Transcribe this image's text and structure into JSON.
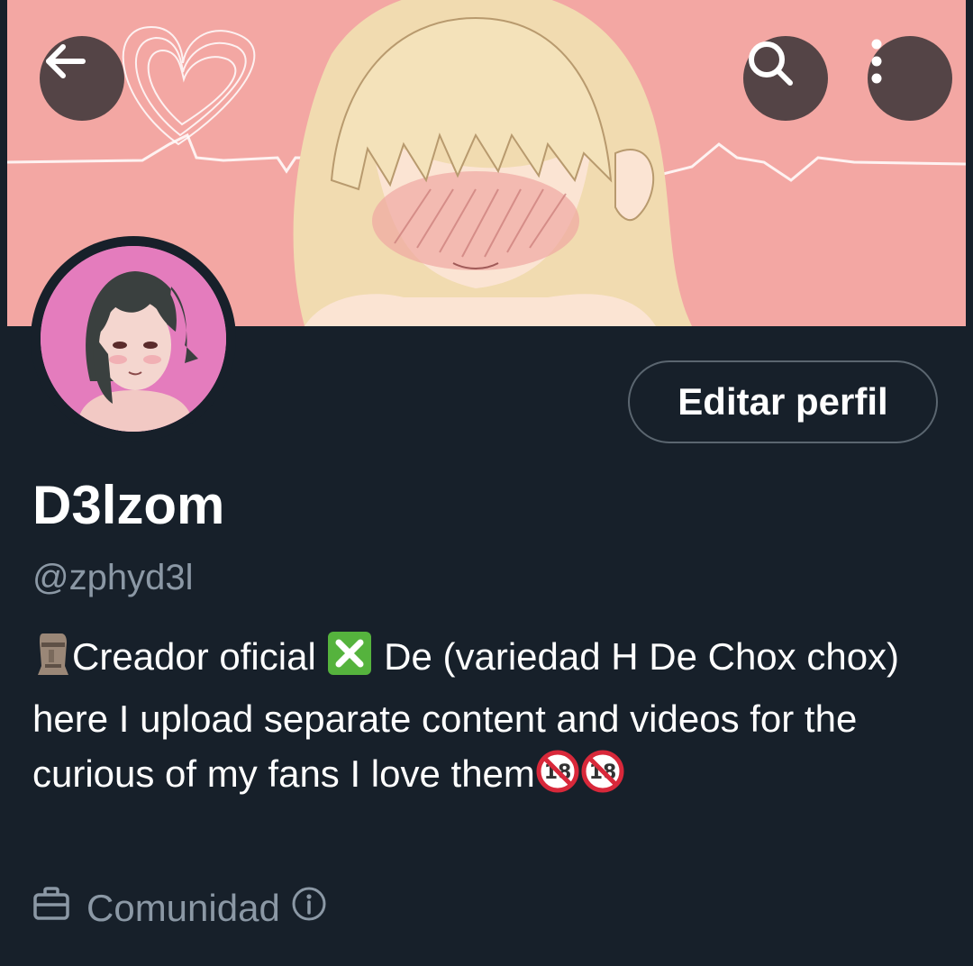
{
  "header": {
    "back_icon": "arrow-left-icon",
    "search_icon": "search-icon",
    "more_icon": "more-vertical-icon"
  },
  "profile": {
    "display_name": "D3lzom",
    "handle": "@zphyd3l",
    "edit_button_label": "Editar perfil",
    "bio": {
      "part1": "Creador oficial",
      "part2": "De (variedad H De Chox chox)   here I upload separate content and videos for the curious of my fans I love them"
    },
    "category": "Comunidad"
  },
  "colors": {
    "background": "#17202a",
    "muted_text": "#8b98a5",
    "banner_pink": "#f2a6a2",
    "button_border": "#5b6670"
  }
}
